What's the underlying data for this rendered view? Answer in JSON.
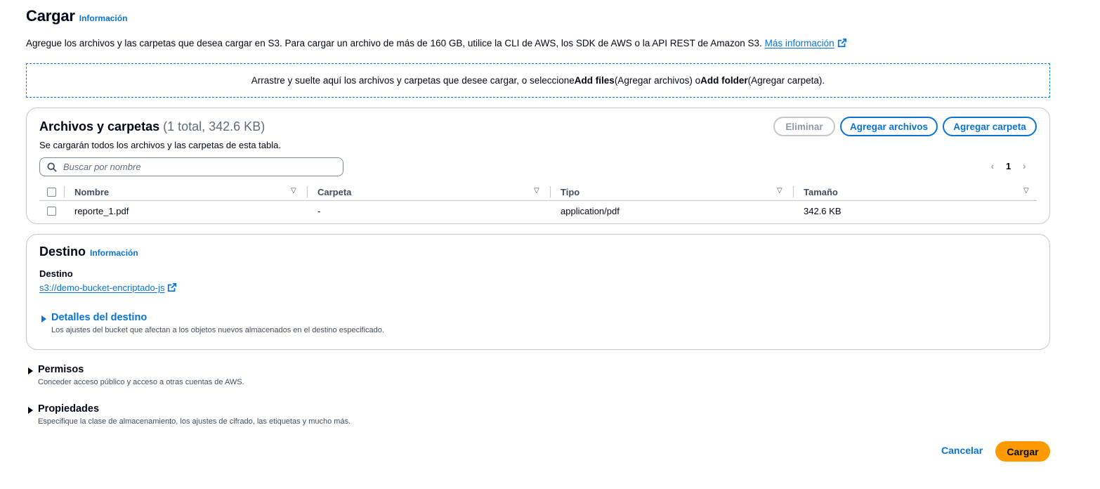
{
  "header": {
    "title": "Cargar",
    "info": "Información",
    "description": "Agregue los archivos y las carpetas que desea cargar en S3. Para cargar un archivo de más de 160 GB, utilice la CLI de AWS, los SDK de AWS o la API REST de Amazon S3.",
    "learn_more": "Más información"
  },
  "dropzone": {
    "text_1": "Arrastre y suelte aquí los archivos y carpetas que desee cargar, o seleccione ",
    "add_files": "Add files",
    "text_2": " (Agregar archivos) o ",
    "add_folder": "Add folder",
    "text_3": " (Agregar carpeta)."
  },
  "files": {
    "title": "Archivos y carpetas",
    "count": "(1 total, 342.6 KB)",
    "subtitle": "Se cargarán todos los archivos y las carpetas de esta tabla.",
    "buttons": {
      "delete": "Eliminar",
      "add_files": "Agregar archivos",
      "add_folder": "Agregar carpeta"
    },
    "search_placeholder": "Buscar por nombre",
    "page": "1",
    "columns": [
      "Nombre",
      "Carpeta",
      "Tipo",
      "Tamaño"
    ],
    "rows": [
      {
        "name": "reporte_1.pdf",
        "folder": "-",
        "type": "application/pdf",
        "size": "342.6 KB"
      }
    ]
  },
  "destination": {
    "title": "Destino",
    "info": "Información",
    "label": "Destino",
    "uri": "s3://demo-bucket-encriptado-js",
    "details_title": "Detalles del destino",
    "details_desc": "Los ajustes del bucket que afectan a los objetos nuevos almacenados en el destino especificado."
  },
  "permissions": {
    "title": "Permisos",
    "desc": "Conceder acceso público y acceso a otras cuentas de AWS."
  },
  "properties": {
    "title": "Propiedades",
    "desc": "Especifique la clase de almacenamiento, los ajustes de cifrado, las etiquetas y mucho más."
  },
  "footer": {
    "cancel": "Cancelar",
    "submit": "Cargar"
  },
  "colors": {
    "accent": "#0972d3",
    "primary_button": "#ff9900",
    "border": "#c6c6cd"
  }
}
